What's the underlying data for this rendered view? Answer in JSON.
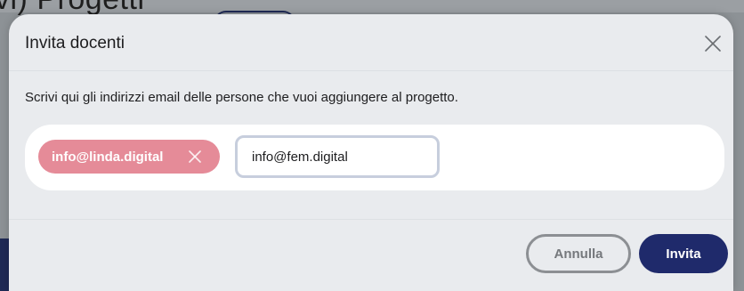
{
  "background": {
    "page_title_fragment": "vi)      Progetti"
  },
  "modal": {
    "title": "Invita docenti",
    "close_icon": "close-icon",
    "description": "Scrivi qui gli indirizzi email delle persone che vuoi aggiungere al progetto.",
    "chips": [
      {
        "label": "info@linda.digital",
        "remove_icon": "close-icon",
        "color": "#e58b98"
      }
    ],
    "input": {
      "value": "info@fem.digital",
      "placeholder": ""
    },
    "footer": {
      "cancel_label": "Annulla",
      "invite_label": "Invita"
    }
  },
  "colors": {
    "primary": "#1f2a6b",
    "chip": "#e58b98",
    "modal_bg": "#e9ebee"
  }
}
